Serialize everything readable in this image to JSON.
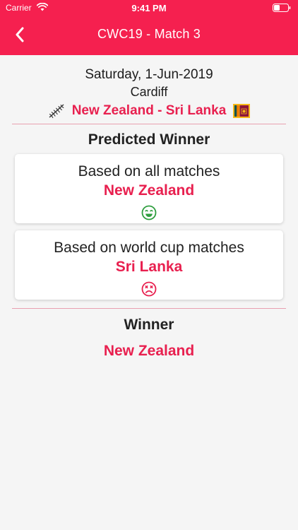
{
  "status_bar": {
    "carrier": "Carrier",
    "time": "9:41 PM"
  },
  "nav": {
    "title": "CWC19 - Match 3",
    "back_icon": "chevron-left-icon"
  },
  "match": {
    "date": "Saturday, 1-Jun-2019",
    "venue": "Cardiff",
    "teams": "New Zealand - Sri Lanka",
    "team1_icon": "silver-fern-icon",
    "team2_icon": "sri-lanka-flag-icon"
  },
  "predicted": {
    "title": "Predicted Winner",
    "cards": [
      {
        "label": "Based on all matches",
        "winner": "New Zealand",
        "outcome_icon": "happy-face-icon",
        "outcome_color": "#2e9e3e"
      },
      {
        "label": "Based on world cup matches",
        "winner": "Sri Lanka",
        "outcome_icon": "sad-face-icon",
        "outcome_color": "#e8204f"
      }
    ]
  },
  "result": {
    "title": "Winner",
    "winner": "New Zealand"
  },
  "colors": {
    "brand": "#f5204f",
    "accent_text": "#e8204f",
    "background": "#f5f5f5"
  }
}
